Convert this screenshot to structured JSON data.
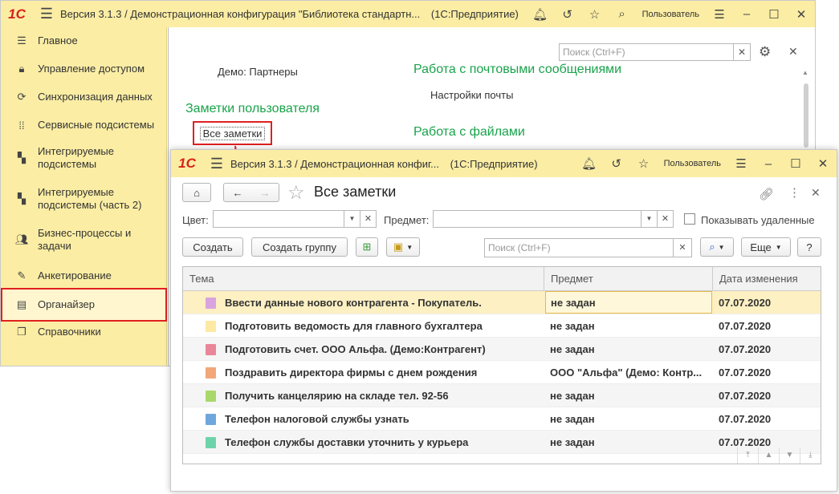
{
  "main_window": {
    "logo": "1С",
    "title": "Версия 3.1.3 / Демонстрационная конфигурация \"Библиотека стандартн...",
    "platform": "(1С:Предприятие)",
    "user": "Пользователь"
  },
  "sidebar": {
    "items": [
      {
        "label": "Главное",
        "icon": "menu-lines-icon"
      },
      {
        "label": "Управление доступом",
        "icon": "lock-icon"
      },
      {
        "label": "Синхронизация данных",
        "icon": "sync-icon"
      },
      {
        "label": "Сервисные подсистемы",
        "icon": "grid-icon"
      },
      {
        "label": "Интегрируемые подсистемы",
        "icon": "blocks-icon"
      },
      {
        "label": "Интегрируемые подсистемы (часть 2)",
        "icon": "blocks-icon"
      },
      {
        "label": "Бизнес-процессы и задачи",
        "icon": "people-icon"
      },
      {
        "label": "Анкетирование",
        "icon": "pencil-icon"
      },
      {
        "label": "Органайзер",
        "icon": "notepad-icon"
      },
      {
        "label": "Справочники",
        "icon": "books-icon"
      }
    ]
  },
  "content": {
    "search_placeholder": "Поиск (Ctrl+F)",
    "link_partners": "Демо: Партнеры",
    "section_mail": "Работа с почтовыми сообщениями",
    "link_mail_settings": "Настройки почты",
    "section_notes": "Заметки пользователя",
    "link_all_notes": "Все заметки",
    "section_files": "Работа с файлами"
  },
  "notes_window": {
    "logo": "1С",
    "title": "Версия 3.1.3 / Демонстрационная конфиг...",
    "platform": "(1С:Предприятие)",
    "user": "Пользователь",
    "form_title": "Все заметки",
    "filters": {
      "color_label": "Цвет:",
      "subject_label": "Предмет:",
      "show_deleted_label": "Показывать удаленные"
    },
    "toolbar": {
      "create": "Создать",
      "create_group": "Создать группу",
      "search_placeholder": "Поиск (Ctrl+F)",
      "more": "Еще",
      "help": "?"
    },
    "table": {
      "columns": [
        "Тема",
        "Предмет",
        "Дата изменения"
      ],
      "rows": [
        {
          "topic": "Ввести данные нового контрагента - Покупатель.",
          "subject": "не задан",
          "date": "07.07.2020",
          "color": "#d9a3e0"
        },
        {
          "topic": "Подготовить ведомость для главного бухгалтера",
          "subject": "не задан",
          "date": "07.07.2020",
          "color": "#fde9a3"
        },
        {
          "topic": "Подготовить счет. ООО Альфа. (Демо:Контрагент)",
          "subject": "не задан",
          "date": "07.07.2020",
          "color": "#e9869a"
        },
        {
          "topic": "Поздравить директора фирмы с днем рождения",
          "subject": "ООО \"Альфа\" (Демо: Контр...",
          "date": "07.07.2020",
          "color": "#f3a778"
        },
        {
          "topic": "Получить канцелярию на складе тел. 92-56",
          "subject": "не задан",
          "date": "07.07.2020",
          "color": "#a9d86a"
        },
        {
          "topic": "Телефон налоговой службы узнать",
          "subject": "не задан",
          "date": "07.07.2020",
          "color": "#6fa7dd"
        },
        {
          "topic": "Телефон службы доставки уточнить у курьера",
          "subject": "не задан",
          "date": "07.07.2020",
          "color": "#6dd4a9"
        }
      ]
    }
  },
  "colors": {
    "title_bar": "#fbeda4",
    "section_green": "#19a34a",
    "highlight_red": "#e02020",
    "selected_row": "#fdf0c2"
  }
}
